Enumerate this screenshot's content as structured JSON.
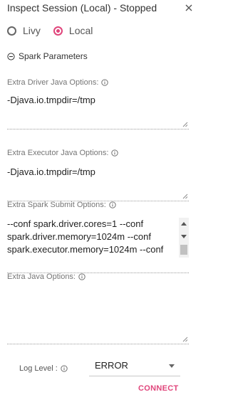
{
  "header": {
    "title": "Inspect Session (Local) - Stopped"
  },
  "mode": {
    "options": [
      {
        "label": "Livy",
        "selected": false
      },
      {
        "label": "Local",
        "selected": true
      }
    ],
    "accent_color": "#e0457b"
  },
  "section": {
    "title": "Spark Parameters"
  },
  "fields": {
    "driver_java": {
      "label": "Extra Driver Java Options:",
      "value": "-Djava.io.tmpdir=/tmp"
    },
    "executor_java": {
      "label": "Extra Executor Java Options:",
      "value": "-Djava.io.tmpdir=/tmp"
    },
    "spark_submit": {
      "label": "Extra Spark Submit Options:",
      "value": "--conf spark.driver.cores=1 --conf spark.driver.memory=1024m --conf spark.executor.memory=1024m --conf"
    },
    "java": {
      "label": "Extra Java Options:",
      "value": ""
    }
  },
  "log_level": {
    "label": "Log Level :",
    "value": "ERROR"
  },
  "actions": {
    "connect_label": "CONNECT"
  }
}
